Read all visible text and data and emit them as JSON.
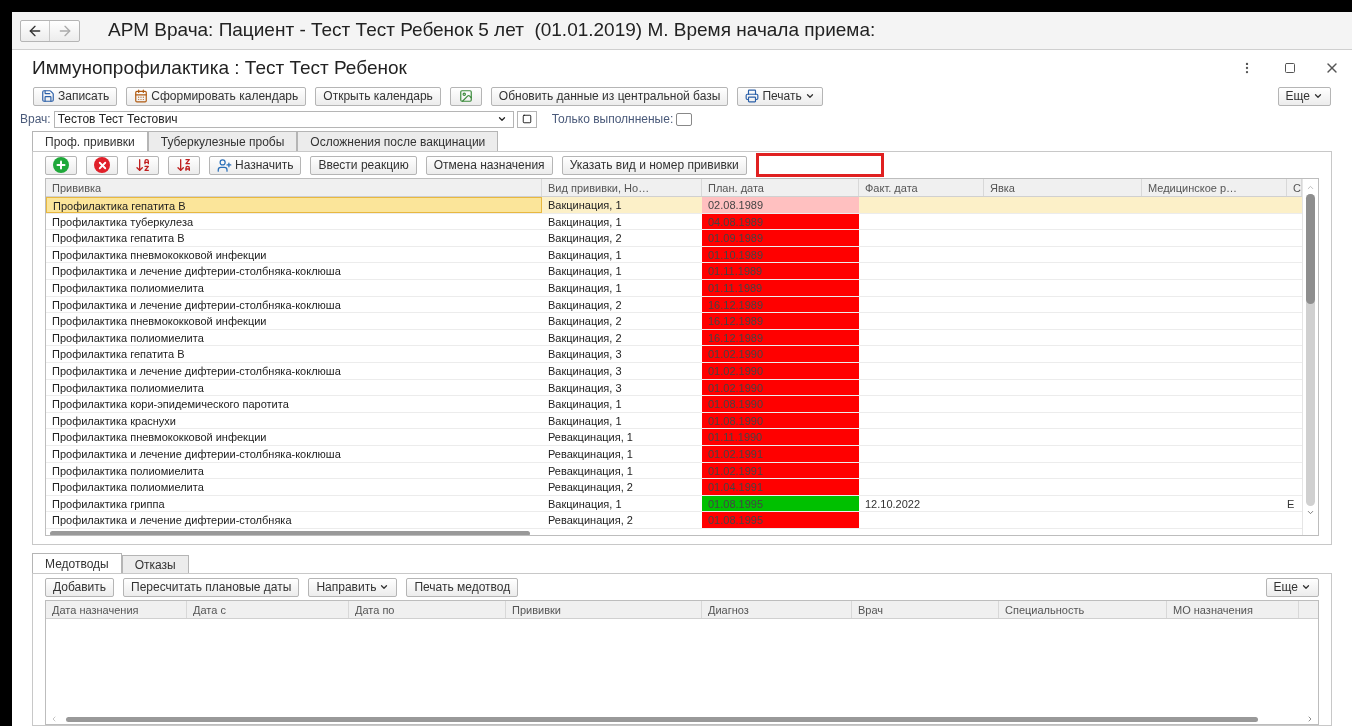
{
  "window": {
    "title": "АРМ Врача: Пациент - Тест Тест Ребенок 5 лет  (01.01.2019) М. Время начала приема:"
  },
  "form": {
    "title": "Иммунопрофилактика : Тест Тест Ребенок"
  },
  "toolbar": [
    {
      "kind": "button",
      "label": "Записать"
    },
    {
      "kind": "button",
      "label": "Сформировать календарь"
    },
    {
      "kind": "button",
      "label": "Открыть календарь"
    },
    {
      "kind": "icon"
    },
    {
      "kind": "button",
      "label": "Обновить данные из центральной базы"
    },
    {
      "kind": "button",
      "label": "Печать",
      "dropdown": true
    }
  ],
  "toolbar_more": "Еще",
  "doctor": {
    "label": "Врач:",
    "value": "Тестов Тест Тестович"
  },
  "only_done": {
    "label": "Только выполнненые:",
    "checked": false
  },
  "tabs": [
    {
      "label": "Проф. прививки",
      "selected": true
    },
    {
      "label": "Туберкулезные пробы",
      "selected": false
    },
    {
      "label": "Осложнения после вакцинации",
      "selected": false
    }
  ],
  "table_toolbar": [
    {
      "kind": "icon"
    },
    {
      "kind": "icon"
    },
    {
      "kind": "icon"
    },
    {
      "kind": "icon"
    },
    {
      "kind": "button",
      "label": "Назначить"
    },
    {
      "kind": "button",
      "label": "Ввести реакцию"
    },
    {
      "kind": "button",
      "label": "Отмена назначения"
    },
    {
      "kind": "button",
      "label": "Указать вид и номер прививки"
    }
  ],
  "table": {
    "columns": [
      "Прививка",
      "Вид прививки, Но…",
      "План. дата",
      "Факт. дата",
      "Явка",
      "Медицинское р…",
      "С"
    ],
    "rows": [
      {
        "name": "Профилактика гепатита В",
        "type": "Вакцинация, 1",
        "plan_date": "02.08.1989",
        "color": "#ffc0c0",
        "selected": true
      },
      {
        "name": "Профилактика туберкулеза",
        "type": "Вакцинация, 1",
        "plan_date": "04.08.1989",
        "color": "#ff0000",
        "selected": false
      },
      {
        "name": "Профилактика гепатита В",
        "type": "Вакцинация, 2",
        "plan_date": "01.09.1989",
        "color": "#ff0000",
        "selected": false
      },
      {
        "name": "Профилактика пневмококковой инфекции",
        "type": "Вакцинация, 1",
        "plan_date": "01.10.1989",
        "color": "#ff0000",
        "selected": false
      },
      {
        "name": "Профилактика и лечение дифтерии-столбняка-коклюша",
        "type": "Вакцинация, 1",
        "plan_date": "01.11.1989",
        "color": "#ff0000",
        "selected": false
      },
      {
        "name": "Профилактика полиомиелита",
        "type": "Вакцинация, 1",
        "plan_date": "01.11.1989",
        "color": "#ff0000",
        "selected": false
      },
      {
        "name": "Профилактика и лечение дифтерии-столбняка-коклюша",
        "type": "Вакцинация, 2",
        "plan_date": "16.12.1989",
        "color": "#ff0000",
        "selected": false
      },
      {
        "name": "Профилактика пневмококковой инфекции",
        "type": "Вакцинация, 2",
        "plan_date": "16.12.1989",
        "color": "#ff0000",
        "selected": false
      },
      {
        "name": "Профилактика полиомиелита",
        "type": "Вакцинация, 2",
        "plan_date": "16.12.1989",
        "color": "#ff0000",
        "selected": false
      },
      {
        "name": "Профилактика гепатита В",
        "type": "Вакцинация, 3",
        "plan_date": "01.02.1990",
        "color": "#ff0000",
        "selected": false
      },
      {
        "name": "Профилактика и лечение дифтерии-столбняка-коклюша",
        "type": "Вакцинация, 3",
        "plan_date": "01.02.1990",
        "color": "#ff0000",
        "selected": false
      },
      {
        "name": "Профилактика полиомиелита",
        "type": "Вакцинация, 3",
        "plan_date": "01.02.1990",
        "color": "#ff0000",
        "selected": false
      },
      {
        "name": "Профилактика кори-эпидемического паротита",
        "type": "Вакцинация, 1",
        "plan_date": "01.08.1990",
        "color": "#ff0000",
        "selected": false
      },
      {
        "name": "Профилактика краснухи",
        "type": "Вакцинация, 1",
        "plan_date": "01.08.1990",
        "color": "#ff0000",
        "selected": false
      },
      {
        "name": "Профилактика пневмококковой инфекции",
        "type": "Ревакцинация, 1",
        "plan_date": "01.11.1990",
        "color": "#ff0000",
        "selected": false
      },
      {
        "name": "Профилактика и лечение дифтерии-столбняка-коклюша",
        "type": "Ревакцинация, 1",
        "plan_date": "01.02.1991",
        "color": "#ff0000",
        "selected": false
      },
      {
        "name": "Профилактика полиомиелита",
        "type": "Ревакцинация, 1",
        "plan_date": "01.02.1991",
        "color": "#ff0000",
        "selected": false
      },
      {
        "name": "Профилактика полиомиелита",
        "type": "Ревакцинация, 2",
        "plan_date": "01.04.1991",
        "color": "#ff0000",
        "selected": false
      },
      {
        "name": "Профилактика гриппа",
        "type": "Вакцинация, 1",
        "plan_date": "01.08.1995",
        "fact_date": "12.10.2022",
        "column_7": "Е",
        "color": "#00c000",
        "selected": false
      },
      {
        "name": "Профилактика и лечение дифтерии-столбняка",
        "type": "Ревакцинация, 2",
        "plan_date": "01.08.1995",
        "color": "#ff0000",
        "selected": false
      }
    ]
  },
  "bottom_tabs": [
    {
      "label": "Медотводы",
      "selected": true
    },
    {
      "label": "Отказы",
      "selected": false
    }
  ],
  "bottom_toolbar": [
    {
      "label": "Добавить"
    },
    {
      "label": "Пересчитать плановые даты"
    },
    {
      "label": "Направить",
      "dropdown": true
    },
    {
      "label": "Печать медотвод"
    }
  ],
  "bottom_more": "Еще",
  "bottom_table": {
    "columns": [
      "Дата назначения",
      "Дата с",
      "Дата по",
      "Прививки",
      "Диагноз",
      "Врач",
      "Специальность",
      "МО назначения"
    ]
  }
}
